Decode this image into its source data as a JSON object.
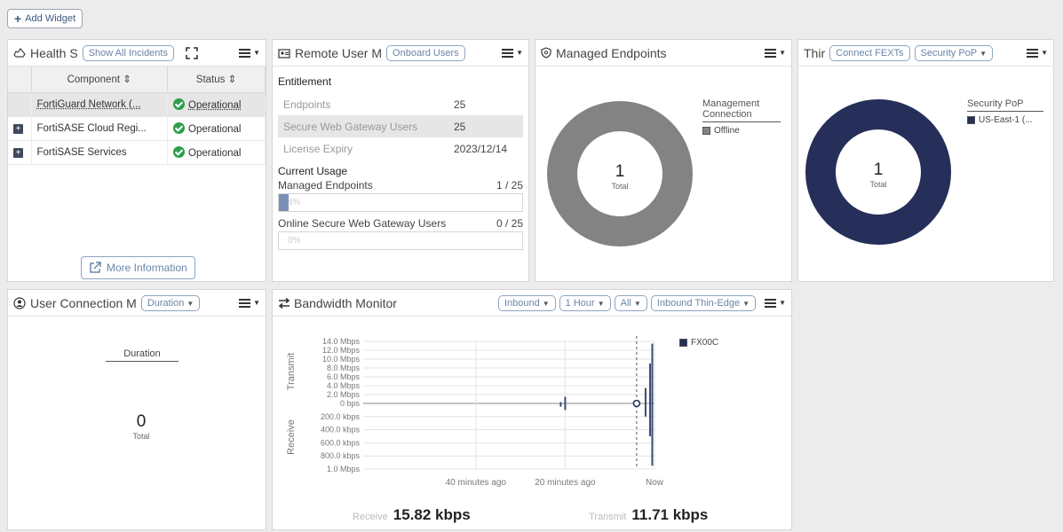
{
  "toolbar": {
    "add_widget": "Add Widget"
  },
  "health": {
    "title": "Health S",
    "show_all": "Show All Incidents",
    "columns": [
      "Component ⇕",
      "Status ⇕"
    ],
    "rows": [
      {
        "component": "FortiGuard Network (...",
        "status": "Operational"
      },
      {
        "component": "FortiSASE Cloud Regi...",
        "status": "Operational"
      },
      {
        "component": "FortiSASE Services",
        "status": "Operational"
      }
    ],
    "more_info": "More Information"
  },
  "remote_user": {
    "title": "Remote User M",
    "onboard": "Onboard Users",
    "entitlement_label": "Entitlement",
    "entitlement": [
      {
        "label": "Endpoints",
        "value": "25"
      },
      {
        "label": "Secure Web Gateway Users",
        "value": "25"
      },
      {
        "label": "License Expiry",
        "value": "2023/12/14"
      }
    ],
    "usage_label": "Current Usage",
    "usage": [
      {
        "label": "Managed Endpoints",
        "value": "1 / 25",
        "fraction": 0.04,
        "pct": "4%"
      },
      {
        "label": "Online Secure Web Gateway Users",
        "value": "0 / 25",
        "fraction": 0.0,
        "pct": "0%"
      }
    ]
  },
  "managed_endpoints": {
    "title": "Managed Endpoints",
    "total": "1",
    "total_label": "Total",
    "legend_title": "Management Connection",
    "legend_items": [
      "Offline"
    ],
    "color": "#838383"
  },
  "third": {
    "title": "Thir",
    "connect": "Connect FEXTs",
    "dropdown": "Security PoP",
    "total": "1",
    "total_label": "Total",
    "legend_title": "Security PoP",
    "legend_items": [
      "US-East-1 (..."
    ],
    "color": "#262e5a"
  },
  "user_conn": {
    "title": "User Connection M",
    "dropdown": "Duration",
    "legend_title": "Duration",
    "total": "0",
    "total_label": "Total"
  },
  "bandwidth": {
    "title": "Bandwidth Monitor",
    "filters": [
      "Inbound",
      "1 Hour",
      "All",
      "Inbound Thin-Edge"
    ],
    "transmit_label": "Transmit",
    "receive_label": "Receive",
    "legend": "FX00C",
    "receive_total_label": "Receive",
    "receive_total": "15.82 kbps",
    "transmit_total_label": "Transmit",
    "transmit_total": "11.71 kbps"
  },
  "chart_data": {
    "type": "area",
    "title": "Bandwidth Monitor",
    "x_tick_labels": [
      "40 minutes ago",
      "20 minutes ago",
      "Now"
    ],
    "y_tick_labels_transmit": [
      "14.0 Mbps",
      "12.0 Mbps",
      "10.0 Mbps",
      "8.0 Mbps",
      "6.0 Mbps",
      "4.0 Mbps",
      "2.0 Mbps",
      "0 bps"
    ],
    "y_tick_labels_receive": [
      "200.0 kbps",
      "400.0 kbps",
      "600.0 kbps",
      "800.0 kbps",
      "1.0 Mbps"
    ],
    "series": [
      {
        "name": "FX00C",
        "transmit_spikes_mbps": [
          {
            "minutes_ago": 21,
            "value": 0.3
          },
          {
            "minutes_ago": 20,
            "value": 1.5
          },
          {
            "minutes_ago": 4,
            "value": 0.5
          },
          {
            "minutes_ago": 2,
            "value": 3.5
          },
          {
            "minutes_ago": 1,
            "value": 9.0
          },
          {
            "minutes_ago": 0.5,
            "value": 13.5
          }
        ],
        "receive_spikes_kbps": [
          {
            "minutes_ago": 21,
            "value": 50
          },
          {
            "minutes_ago": 20,
            "value": 100
          },
          {
            "minutes_ago": 2,
            "value": 200
          },
          {
            "minutes_ago": 1,
            "value": 500
          },
          {
            "minutes_ago": 0.5,
            "value": 950
          }
        ]
      }
    ],
    "grid": true,
    "legend": "top-right"
  }
}
